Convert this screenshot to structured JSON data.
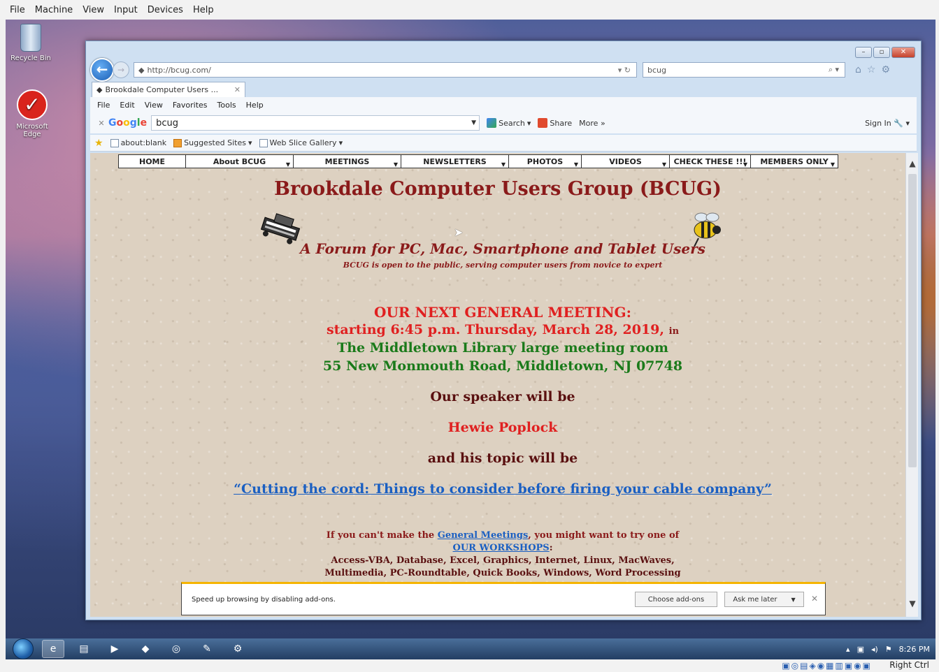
{
  "host_menu": {
    "items": [
      "File",
      "Machine",
      "View",
      "Input",
      "Devices",
      "Help"
    ]
  },
  "desktop": {
    "icons": [
      {
        "label": "Recycle Bin"
      },
      {
        "label": "Microsoft\nEdge"
      }
    ]
  },
  "browser": {
    "address": "http://bcug.com/",
    "search_text": "bcug",
    "tab_title": "Brookdale Computer Users ...",
    "menu": [
      "File",
      "Edit",
      "View",
      "Favorites",
      "Tools",
      "Help"
    ],
    "google_toolbar": {
      "logo": "Google",
      "query": "bcug",
      "search_label": "Search",
      "share_label": "Share",
      "more_label": "More »",
      "signin_label": "Sign In"
    },
    "favorites": {
      "items": [
        "about:blank",
        "Suggested Sites",
        "Web Slice Gallery"
      ]
    }
  },
  "site": {
    "nav": [
      "HOME",
      "About BCUG",
      "MEETINGS",
      "NEWSLETTERS",
      "PHOTOS",
      "VIDEOS",
      "CHECK THESE !!!",
      "MEMBERS ONLY"
    ],
    "title": "Brookdale Computer Users Group (BCUG)",
    "tagline": "A Forum for PC, Mac, Smartphone and Tablet Users",
    "subtag": "BCUG is open to the public, serving computer users from novice to expert",
    "meeting": {
      "heading": "OUR NEXT GENERAL MEETING:",
      "time": "starting 6:45 p.m. Thursday, March 28, 2019,",
      "in_word": "in",
      "place": "The Middletown Library large meeting room",
      "address": "55 New Monmouth Road, Middletown, NJ 07748"
    },
    "speaker_intro": "Our speaker will be",
    "speaker_name": "Hewie Poplock",
    "topic_intro": "and his topic will be",
    "topic": "“Cutting the cord: Things to consider before firing your cable company”",
    "workshops": {
      "prefix": "If you can't make the",
      "link1": "General Meetings",
      "suffix": ", you might want to try one of",
      "link2": "OUR WORKSHOPS",
      "colon": ":",
      "list1": "Access-VBA, Database, Excel, Graphics, Internet, Linux, MacWaves,",
      "list2": "Multimedia, PC-Roundtable, Quick Books, Windows, Word Processing"
    }
  },
  "notification": {
    "message": "Speed up browsing by disabling add-ons.",
    "choose_label": "Choose add-ons",
    "ask_label": "Ask me later"
  },
  "taskbar": {
    "time": "8:26 PM"
  },
  "host_status": {
    "key_label": "Right Ctrl"
  }
}
